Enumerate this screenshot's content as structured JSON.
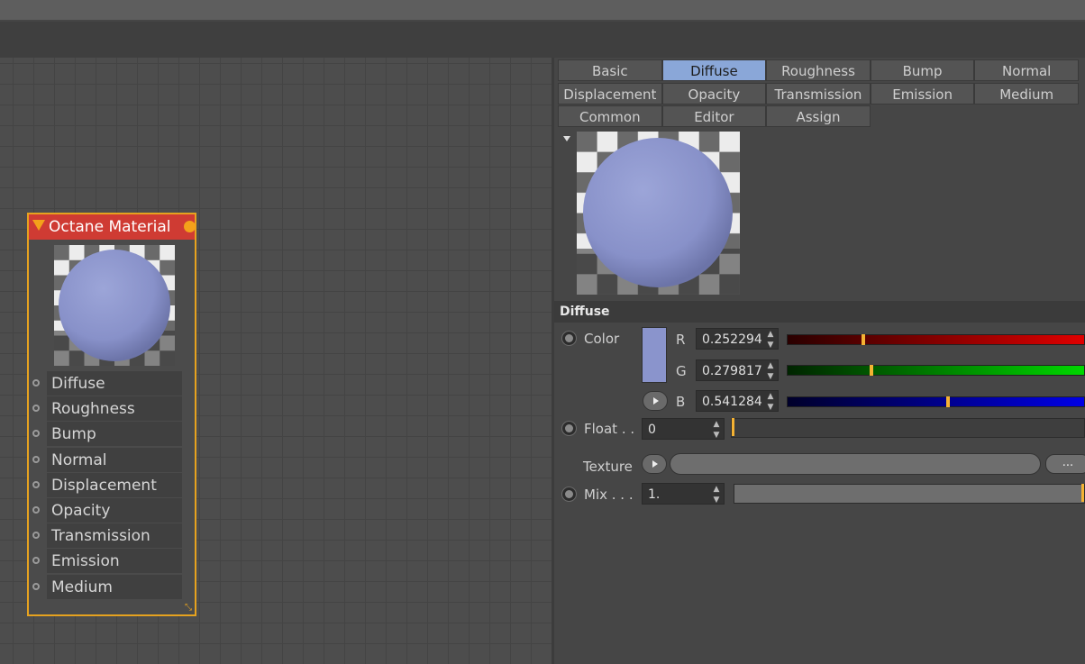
{
  "node": {
    "title": "Octane Material",
    "ports": [
      "Diffuse",
      "Roughness",
      "Bump",
      "Normal",
      "Displacement",
      "Opacity",
      "Transmission",
      "Emission",
      "Medium"
    ]
  },
  "tabs": [
    {
      "label": "Basic",
      "active": false
    },
    {
      "label": "Diffuse",
      "active": true
    },
    {
      "label": "Roughness",
      "active": false
    },
    {
      "label": "Bump",
      "active": false
    },
    {
      "label": "Normal",
      "active": false
    },
    {
      "label": "Displacement",
      "active": false
    },
    {
      "label": "Opacity",
      "active": false
    },
    {
      "label": "Transmission",
      "active": false
    },
    {
      "label": "Emission",
      "active": false
    },
    {
      "label": "Medium",
      "active": false
    },
    {
      "label": "Common",
      "active": false
    },
    {
      "label": "Editor",
      "active": false
    },
    {
      "label": "Assign",
      "active": false
    }
  ],
  "section": {
    "title": "Diffuse"
  },
  "color": {
    "label": "Color",
    "swatch": "#8a94cc",
    "r": {
      "label": "R",
      "value": "0.252294",
      "fraction": 0.252294
    },
    "g": {
      "label": "G",
      "value": "0.279817",
      "fraction": 0.279817
    },
    "b": {
      "label": "B",
      "value": "0.541284",
      "fraction": 0.541284
    }
  },
  "float": {
    "label": "Float . .",
    "value": "0",
    "fraction": 0
  },
  "texture": {
    "label": "Texture",
    "browse": "..."
  },
  "mix": {
    "label": "Mix . . .",
    "value": "1.",
    "fraction": 1
  },
  "colors": {
    "accent_orange": "#e6a21f",
    "node_header": "#cf3b33",
    "active_tab": "#8aa7d8",
    "sphere": "#8a94cc"
  }
}
